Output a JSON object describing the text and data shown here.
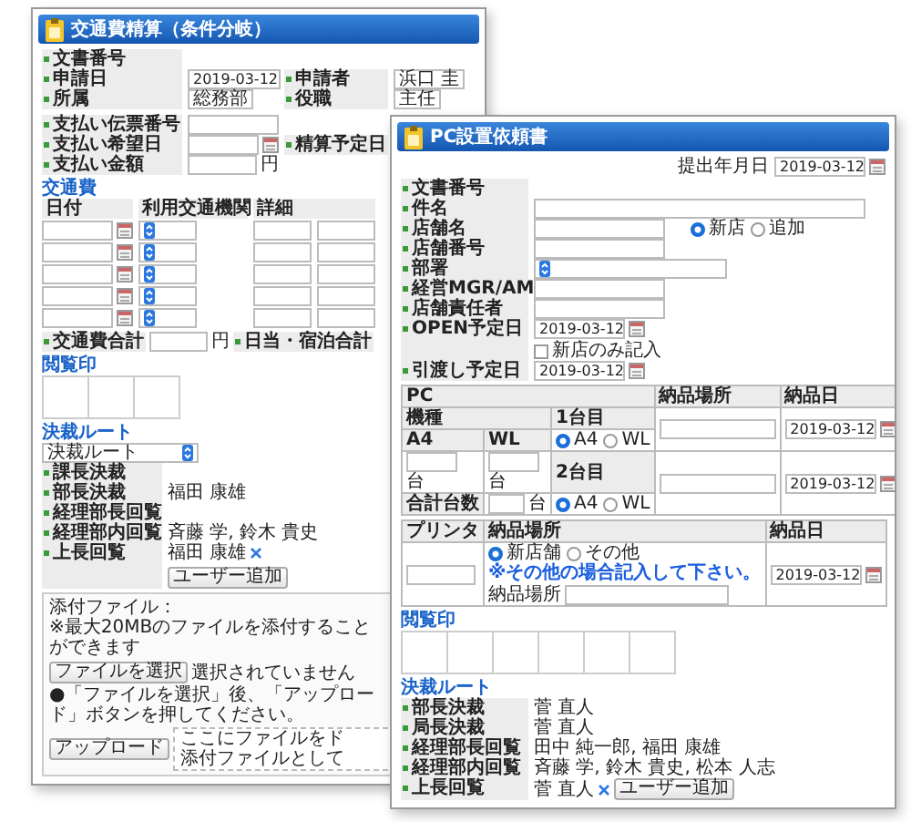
{
  "back_window": {
    "title": "交通費精算（条件分岐）",
    "header_rows": [
      [
        {
          "label": "文書番号"
        }
      ],
      [
        {
          "label": "申請日",
          "value": "2019-03-12",
          "kind": "date"
        },
        {
          "label": "申請者",
          "value": "浜口 圭",
          "kind": "text"
        }
      ],
      [
        {
          "label": "所属",
          "value": "総務部",
          "kind": "text"
        },
        {
          "label": "役職",
          "value": "主任",
          "kind": "text"
        }
      ]
    ],
    "payment_rows": [
      [
        {
          "label": "支払い伝票番号",
          "kind": "text"
        }
      ],
      [
        {
          "label": "支払い希望日",
          "kind": "date"
        },
        {
          "label": "精算予定日",
          "kind": "label"
        }
      ],
      [
        {
          "label": "支払い金額",
          "kind": "amount",
          "unit": "円"
        }
      ]
    ],
    "expenses": {
      "title": "交通費",
      "columns": [
        "日付",
        "利用交通機関",
        "詳細"
      ]
    },
    "totals": [
      {
        "label": "交通費合計",
        "unit": "円"
      },
      {
        "label": "日当・宿泊合計"
      }
    ],
    "stamps_title": "閲覧印",
    "route": {
      "title": "決裁ルート",
      "select": "決裁ルート",
      "rows": [
        {
          "label": "課長決裁"
        },
        {
          "label": "部長決裁",
          "value": "福田 康雄"
        },
        {
          "label": "経理部長回覧"
        },
        {
          "label": "経理部内回覧",
          "value": "斉藤 学, 鈴木 貴史"
        },
        {
          "label": "上長回覧",
          "value": "福田 康雄",
          "add_user": "ユーザー追加"
        }
      ]
    },
    "attachments": {
      "label": "添付ファイル：",
      "note": "※最大20MBのファイルを添付することができます",
      "file_button": "ファイルを選択",
      "file_status": "選択されていません",
      "hint": "●「ファイルを選択」後、「アップロード」ボタンを押してください。",
      "upload_button": "アップロード",
      "drop_zone": [
        "ここにファイルをド",
        "添付ファイルとして"
      ]
    }
  },
  "front_window": {
    "title": "PC設置依頼書",
    "submit_date": {
      "label": "提出年月日",
      "value": "2019-03-12"
    },
    "rows": [
      {
        "label": "文書番号",
        "kind": "none"
      },
      {
        "label": "件名",
        "kind": "wide"
      },
      {
        "label": "店舗名",
        "kind": "text_radio",
        "options": [
          {
            "label": "新店",
            "selected": true
          },
          {
            "label": "追加",
            "selected": false
          }
        ]
      },
      {
        "label": "店舗番号",
        "kind": "text"
      },
      {
        "label": "部署",
        "kind": "select"
      },
      {
        "label": "経営MGR/AM",
        "kind": "text"
      },
      {
        "label": "店舗責任者",
        "kind": "text"
      },
      {
        "label": "OPEN予定日",
        "kind": "date_check",
        "value": "2019-03-12",
        "check": {
          "label": "新店のみ記入",
          "checked": false
        }
      },
      {
        "label": "引渡し予定日",
        "kind": "date",
        "value": "2019-03-12"
      }
    ],
    "pc_table": {
      "columns": [
        "PC",
        "納品場所",
        "納品日"
      ],
      "model": "機種",
      "sizes": [
        "A4",
        "WL"
      ],
      "unit_labels": [
        "台",
        "台"
      ],
      "total": {
        "label": "合計台数",
        "unit": "台"
      },
      "machines": [
        {
          "label": "1台目",
          "options": [
            {
              "label": "A4",
              "selected": true
            },
            {
              "label": "WL",
              "selected": false
            }
          ],
          "date": "2019-03-12"
        },
        {
          "label": "2台目",
          "options": [
            {
              "label": "A4",
              "selected": true
            },
            {
              "label": "WL",
              "selected": false
            }
          ],
          "date": "2019-03-12"
        }
      ]
    },
    "printer_table": {
      "columns": [
        "プリンタ",
        "納品場所",
        "納品日"
      ],
      "options": [
        {
          "label": "新店舗",
          "selected": true
        },
        {
          "label": "その他",
          "selected": false
        }
      ],
      "note": "※その他の場合記入して下さい。",
      "place_label": "納品場所",
      "date": "2019-03-12"
    },
    "stamps_title": "閲覧印",
    "route": {
      "title": "決裁ルート",
      "rows": [
        {
          "label": "部長決裁",
          "value": "菅 直人"
        },
        {
          "label": "局長決裁",
          "value": "菅 直人"
        },
        {
          "label": "経理部長回覧",
          "value": "田中 純一郎, 福田 康雄"
        },
        {
          "label": "経理部内回覧",
          "value": "斉藤 学, 鈴木 貴史, 松本 人志"
        },
        {
          "label": "上長回覧",
          "value": "菅 直人",
          "add_user": "ユーザー追加"
        }
      ]
    }
  }
}
